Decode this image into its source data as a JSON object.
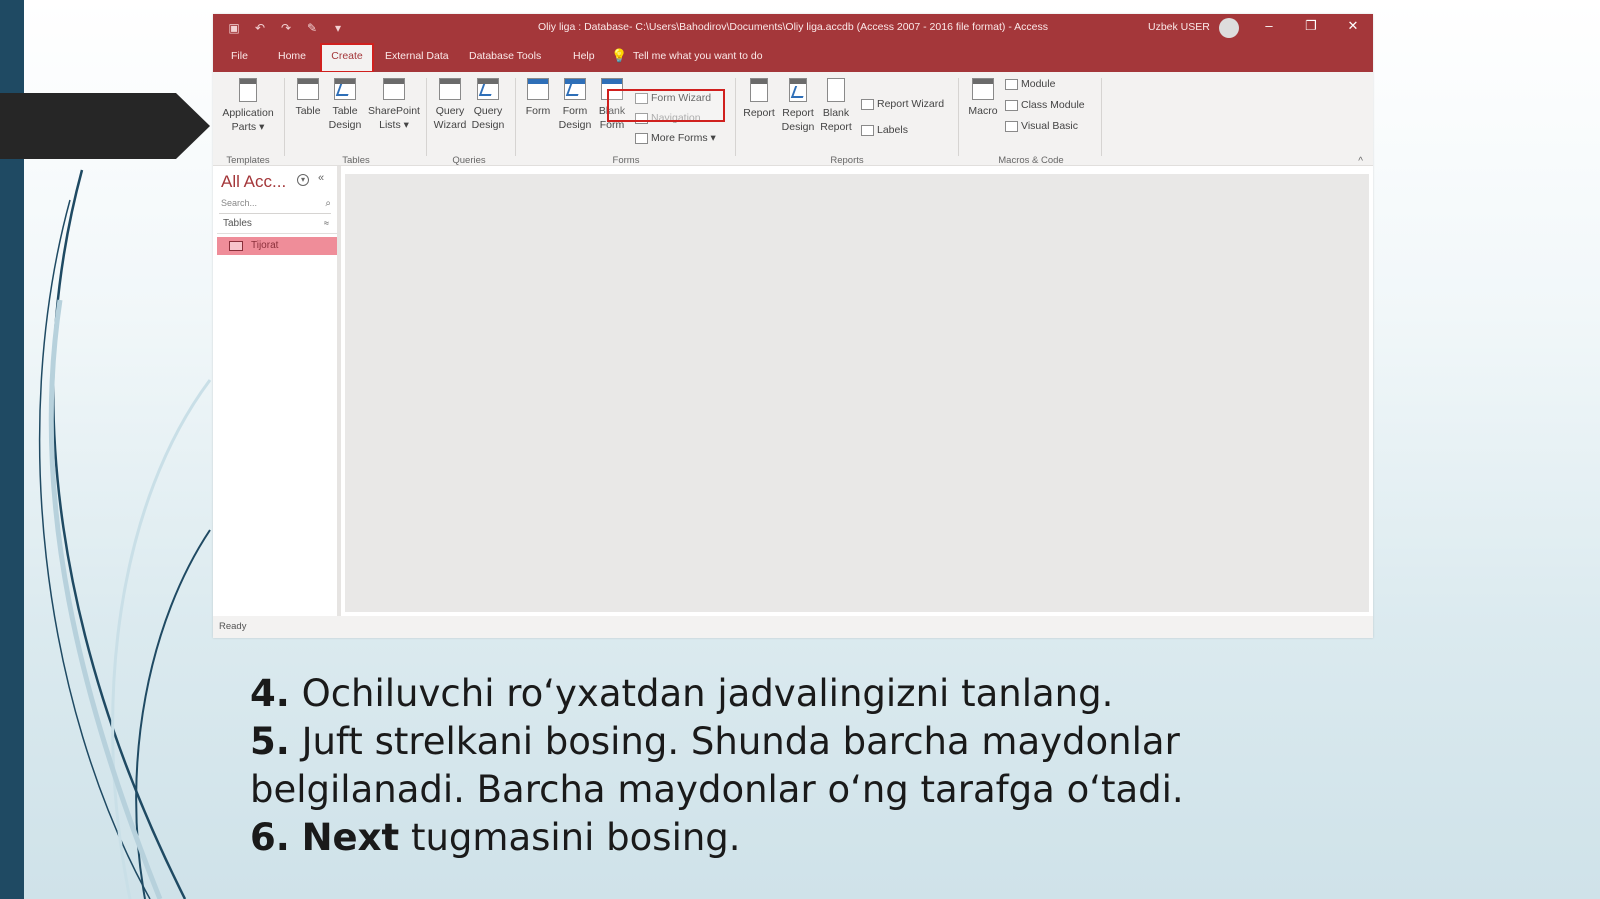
{
  "window": {
    "title": "Oliy liga : Database- C:\\Users\\Bahodirov\\Documents\\Oliy liga.accdb (Access 2007 - 2016 file format) - Access",
    "user": "Uzbek USER",
    "minimize": "–",
    "restore": "❐",
    "close": "✕"
  },
  "qat": [
    "▣",
    "↶",
    "↷",
    "✎",
    "▾"
  ],
  "tabs": {
    "file": "File",
    "home": "Home",
    "create": "Create",
    "external": "External Data",
    "dbtools": "Database Tools",
    "help": "Help",
    "tellme": "Tell me what you want to do"
  },
  "ribbon": {
    "templates": {
      "app_parts_1": "Application",
      "app_parts_2": "Parts ▾",
      "label": "Templates"
    },
    "tables": {
      "table": "Table",
      "table_design_1": "Table",
      "table_design_2": "Design",
      "sharepoint_1": "SharePoint",
      "sharepoint_2": "Lists ▾",
      "label": "Tables"
    },
    "queries": {
      "wizard_1": "Query",
      "wizard_2": "Wizard",
      "design_1": "Query",
      "design_2": "Design",
      "label": "Queries"
    },
    "forms": {
      "form": "Form",
      "form_design_1": "Form",
      "form_design_2": "Design",
      "blank_form_1": "Blank",
      "blank_form_2": "Form",
      "form_wizard": "Form Wizard",
      "navigation": "Navigation",
      "more_forms": "More Forms ▾",
      "label": "Forms"
    },
    "reports": {
      "report": "Report",
      "report_design_1": "Report",
      "report_design_2": "Design",
      "blank_report_1": "Blank",
      "blank_report_2": "Report",
      "report_wizard": "Report Wizard",
      "labels": "Labels",
      "label": "Reports"
    },
    "macros": {
      "macro": "Macro",
      "module": "Module",
      "class_module": "Class Module",
      "visual_basic": "Visual Basic",
      "label": "Macros & Code"
    },
    "collapse": "^"
  },
  "nav": {
    "title": "All Acc...",
    "dropdown": "▾",
    "collapse": "«",
    "search_placeholder": "Search...",
    "search_icon": "⌕",
    "section": "Tables",
    "section_chevron": "≈",
    "item": "Tijorat"
  },
  "status": "Ready",
  "instructions": [
    {
      "num": "4.",
      "text": " Ochiluvchi ro‘yxatdan jadvalingizni tanlang."
    },
    {
      "num": "5.",
      "text": " Juft strelkani bosing. Shunda barcha maydonlar"
    },
    {
      "num": "",
      "text": "belgilanadi. Barcha maydonlar o‘ng tarafga o‘tadi."
    },
    {
      "num": "6.",
      "bold": "Next",
      "text": " tugmasini bosing."
    }
  ]
}
